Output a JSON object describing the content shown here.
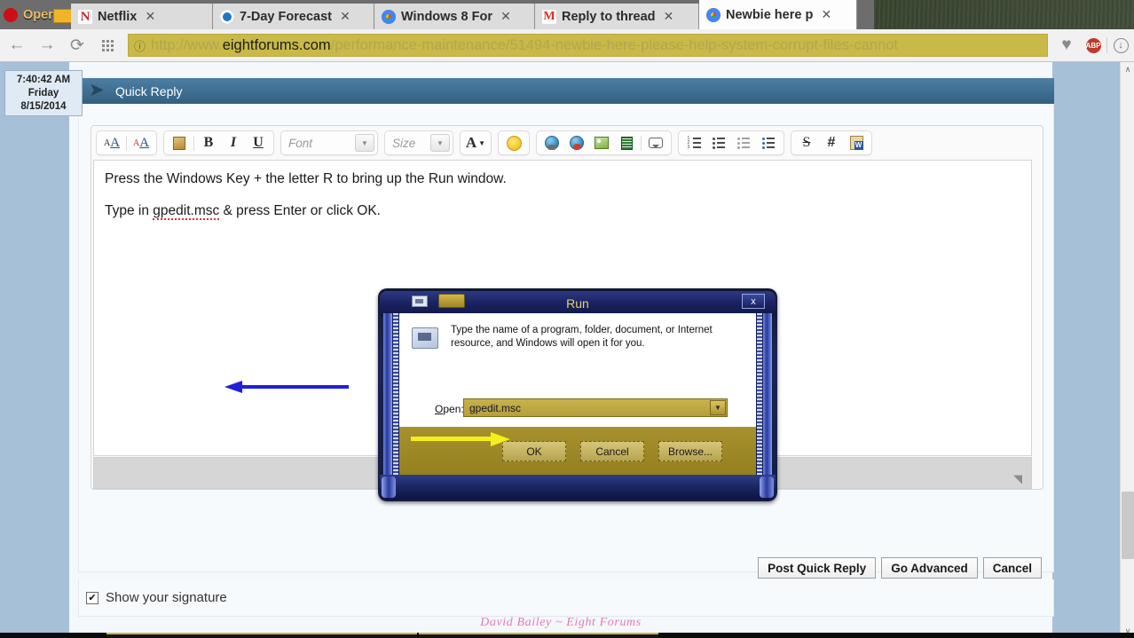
{
  "browser": {
    "tabs": [
      {
        "title": "Opera",
        "favicon": "opera-icon",
        "active": false,
        "closable": false
      },
      {
        "title": "Netflix",
        "favicon": "netflix-icon",
        "active": false,
        "closable": true
      },
      {
        "title": "7-Day Forecast",
        "favicon": "weather-icon",
        "active": false,
        "closable": true
      },
      {
        "title": "Windows 8 For",
        "favicon": "chrome-icon",
        "active": false,
        "closable": true
      },
      {
        "title": "Reply to thread",
        "favicon": "gmail-icon",
        "active": false,
        "closable": true
      },
      {
        "title": "Newbie here p",
        "favicon": "chrome-icon",
        "active": true,
        "closable": true
      }
    ],
    "nav": {
      "back_label": "←",
      "forward_label": "→",
      "reload_label": "⟳",
      "apps_label": "apps-grid-icon"
    },
    "omnibox": {
      "security_glyph": "ⓘ",
      "url_prefix": "http://www.",
      "url_domain": "eightforums.com",
      "url_path": "/performance-maintenance/51494-newbie-here-please-help-system-corrupt-files-cannot"
    },
    "actions": {
      "bookmark_label": "♥",
      "adblock_label": "ABP",
      "download_label": "↓"
    }
  },
  "clock": {
    "time": "7:40:42 AM",
    "day": "Friday",
    "date": "8/15/2014"
  },
  "quick_reply": {
    "header_title": "Quick Reply",
    "collapse_icon": "chevron-collapse-icon"
  },
  "toolbar": {
    "groups": [
      {
        "buttons": [
          {
            "name": "toggle-editor-mode-button",
            "glyph": "A̲A",
            "label": "Toggle Editor Mode"
          },
          {
            "name": "remove-formatting-button",
            "glyph": "A̲A̶",
            "label": "Remove Text Formatting"
          }
        ]
      },
      {
        "buttons": [
          {
            "name": "paste-button",
            "glyph": "paste-icon",
            "label": "Paste"
          },
          {
            "name": "bold-button",
            "glyph": "B",
            "label": "Bold"
          },
          {
            "name": "italic-button",
            "glyph": "I",
            "label": "Italic"
          },
          {
            "name": "underline-button",
            "glyph": "U",
            "label": "Underline"
          }
        ]
      }
    ],
    "font_field": {
      "placeholder": "Font",
      "value": ""
    },
    "size_field": {
      "placeholder": "Size",
      "value": ""
    },
    "font_color_label": "A",
    "smilies_label": "smiley-icon",
    "link_label": "insert-link-icon",
    "unlink_label": "remove-link-icon",
    "image_label": "insert-image-icon",
    "video_label": "insert-video-icon",
    "quote_label": "wrap-quote-icon",
    "ordered_list_label": "ordered-list-icon",
    "unordered_list_label": "unordered-list-icon",
    "outdent_label": "outdent-icon",
    "indent_label": "indent-icon",
    "strike_label": "S",
    "hash_label": "#",
    "word_paste_label": "paste-from-word-icon"
  },
  "post": {
    "line1": "Press the Windows Key + the letter R to bring up the Run window.",
    "line2_pre": "Type in ",
    "line2_cmd": "gpedit.msc",
    "line2_post": " & press Enter or click OK."
  },
  "run_dialog": {
    "title": "Run",
    "close_label": "x",
    "description": "Type the name of a program, folder, document, or Internet resource, and Windows will open it for you.",
    "open_label_underlined": "O",
    "open_label_rest": "pen:",
    "open_value": "gpedit.msc",
    "dropdown_glyph": "▼",
    "buttons": [
      {
        "name": "run-ok-button",
        "label": "OK"
      },
      {
        "name": "run-cancel-button",
        "label": "Cancel"
      },
      {
        "name": "run-browse-button",
        "label": "Browse..."
      }
    ],
    "annotations": {
      "blue_arrow": "blue-arrow-pointing-to-open-field",
      "yellow_arrow": "yellow-arrow-pointing-to-ok-button"
    }
  },
  "editor": {
    "resize_handle": "resize-grip-icon",
    "resize_glyph": "◥"
  },
  "signature_option": {
    "checked": true,
    "check_glyph": "✔",
    "label": "Show your signature"
  },
  "actions": {
    "post_quick_reply": "Post Quick Reply",
    "go_advanced": "Go Advanced",
    "cancel": "Cancel"
  },
  "signature": {
    "text": "David Bailey ~ Eight Forums"
  },
  "scrollbar": {
    "up_glyph": "∧",
    "down_glyph": "∨"
  },
  "colors": {
    "accent": "#3f6f93",
    "omnibox": "#c9b949",
    "page_gutter": "#a6c0d8",
    "signature": "#e77ab5",
    "blue_arrow": "#2020d8",
    "yellow_arrow": "#f4ef1a"
  }
}
